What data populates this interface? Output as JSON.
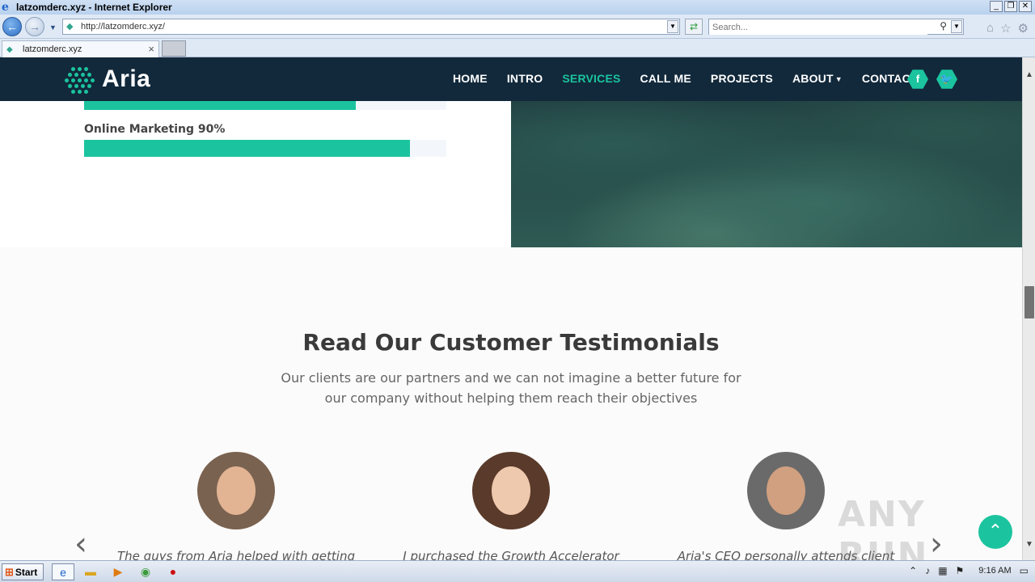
{
  "window": {
    "title": "latzomderc.xyz - Internet Explorer"
  },
  "browser": {
    "address": "http://latzomderc.xyz/",
    "search_placeholder": "Search...",
    "tab_label": "latzomderc.xyz"
  },
  "site": {
    "brand": "Aria",
    "menu": [
      "HOME",
      "INTRO",
      "SERVICES",
      "CALL ME",
      "PROJECTS",
      "ABOUT",
      "CONTACT"
    ],
    "active_menu": "SERVICES",
    "social": [
      "f",
      "t"
    ]
  },
  "skills": [
    {
      "label": "",
      "percent": 75
    },
    {
      "label": "Online Marketing 90%",
      "percent": 90
    }
  ],
  "testimonials": {
    "title": "Read Our Customer Testimonials",
    "subtitle": "Our clients are our partners and we can not imagine a better future for our company without helping them reach their objectives",
    "quotes": [
      "The guys from Aria helped with getting",
      "I purchased the Growth Accelerator",
      "Aria's CEO personally attends client"
    ]
  },
  "watermark": "ANY RUN",
  "taskbar": {
    "start_label": "Start",
    "clock": "9:16 AM"
  },
  "colors": {
    "accent": "#1bc49f",
    "nav_bg": "#12293b"
  }
}
